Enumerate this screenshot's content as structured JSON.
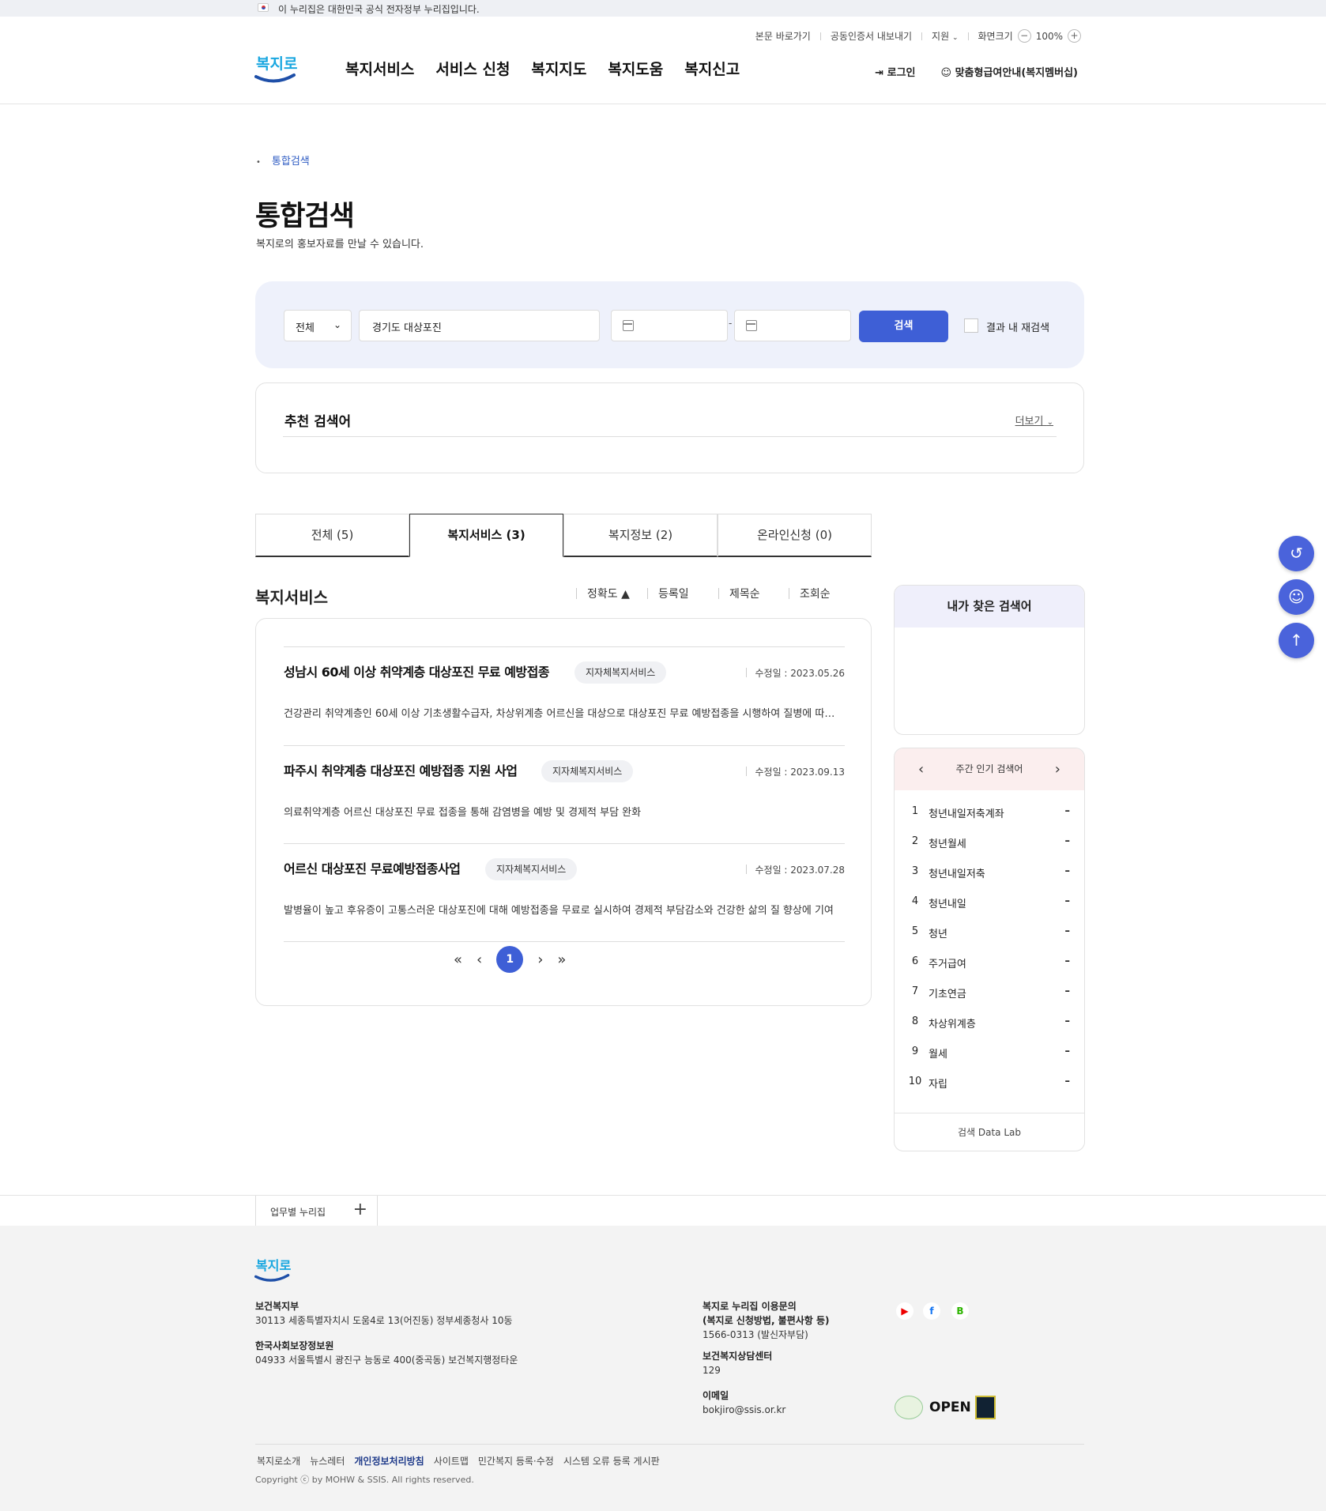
{
  "gov_banner": "이 누리집은 대한민국 공식 전자정부 누리집입니다.",
  "util": {
    "skip": "본문 바로가기",
    "cert": "공동인증서 내보내기",
    "region": "지원",
    "zoom_label": "화면크기",
    "zoom_minus": "−",
    "zoom_value": "100%",
    "zoom_plus": "+"
  },
  "logo_text": "복지로",
  "gnb": [
    "복지서비스",
    "서비스 신청",
    "복지지도",
    "복지도움",
    "복지신고"
  ],
  "header_right": {
    "login": "로그인",
    "membership": "맞춤형급여안내(복지멤버십)"
  },
  "breadcrumb": "통합검색",
  "page_title": "통합검색",
  "page_subtitle": "복지로의 홍보자료를 만날 수 있습니다.",
  "search": {
    "category": "전체",
    "keyword": "경기도 대상포진",
    "date_sep": "-",
    "button": "검색",
    "research_label": "결과 내 재검색"
  },
  "recommend": {
    "title": "추천 검색어",
    "more": "더보기"
  },
  "tabs": [
    "전체 (5)",
    "복지서비스 (3)",
    "복지정보 (2)",
    "온라인신청 (0)"
  ],
  "list_title": "복지서비스",
  "sort": [
    "정확도 ▲",
    "등록일",
    "제목순",
    "조회순"
  ],
  "results": [
    {
      "title": "성남시 60세 이상 취약계층 대상포진 무료 예방접종",
      "badge": "지자체복지서비스",
      "date": "수정일 : 2023.05.26",
      "desc": "건강관리 취약계층인 60세 이상 기초생활수급자, 차상위계층 어르신을 대상으로 대상포진 무료 예방접종을 시행하여 질병에 따른 ..."
    },
    {
      "title": "파주시 취약계층 대상포진 예방접종 지원 사업",
      "badge": "지자체복지서비스",
      "date": "수정일 : 2023.09.13",
      "desc": "의료취약계층 어르신 대상포진 무료 접종을 통해 감염병을 예방 및 경제적 부담 완화"
    },
    {
      "title": "어르신 대상포진 무료예방접종사업",
      "badge": "지자체복지서비스",
      "date": "수정일 : 2023.07.28",
      "desc": "발병율이 높고 후유증이 고통스러운 대상포진에 대해 예방접종을 무료로 실시하여 경제적 부담감소와 건강한 삶의 질 향상에 기여"
    }
  ],
  "pager": {
    "current": "1"
  },
  "my_search_title": "내가 찾은 검색어",
  "popular": {
    "title": "주간 인기 검색어",
    "items": [
      {
        "rank": "1",
        "word": "청년내일저축계좌",
        "mark": "–"
      },
      {
        "rank": "2",
        "word": "청년월세",
        "mark": "–"
      },
      {
        "rank": "3",
        "word": "청년내일저축",
        "mark": "–"
      },
      {
        "rank": "4",
        "word": "청년내일",
        "mark": "–"
      },
      {
        "rank": "5",
        "word": "청년",
        "mark": "–"
      },
      {
        "rank": "6",
        "word": "주거급여",
        "mark": "–"
      },
      {
        "rank": "7",
        "word": "기초연금",
        "mark": "–"
      },
      {
        "rank": "8",
        "word": "차상위계층",
        "mark": "–"
      },
      {
        "rank": "9",
        "word": "월세",
        "mark": "–"
      },
      {
        "rank": "10",
        "word": "자립",
        "mark": "–"
      }
    ],
    "footer": "검색 Data Lab"
  },
  "family_site": "업무별 누리집",
  "footer": {
    "org1_name": "보건복지부",
    "org1_addr": "30113 세종특별자치시 도움4로 13(어진동) 정부세종청사 10동",
    "org2_name": "한국사회보장정보원",
    "org2_addr": "04933 서울특별시 광진구 능동로 400(중곡동) 보건복지행정타운",
    "inq_title1": "복지로 누리집 이용문의",
    "inq_title2": "(복지로 신청방법, 불편사항 등)",
    "inq_phone": "1566-0313 (발신자부담)",
    "center_title": "보건복지상담센터",
    "center_phone": "129",
    "email_title": "이메일",
    "email": "bokjiro@ssis.or.kr",
    "open_mark": "OPEN",
    "links": [
      "복지로소개",
      "뉴스레터",
      "개인정보처리방침",
      "사이트맵",
      "민간복지 등록·수정",
      "시스템 오류 등록 게시판"
    ],
    "copyright": "Copyright ⓒ by MOHW & SSIS. All rights reserved."
  },
  "colors": {
    "primary": "#3e5fd6",
    "search_bg": "#eef1fb",
    "popular_header": "#fbeeee",
    "my_header": "#efeffb"
  }
}
